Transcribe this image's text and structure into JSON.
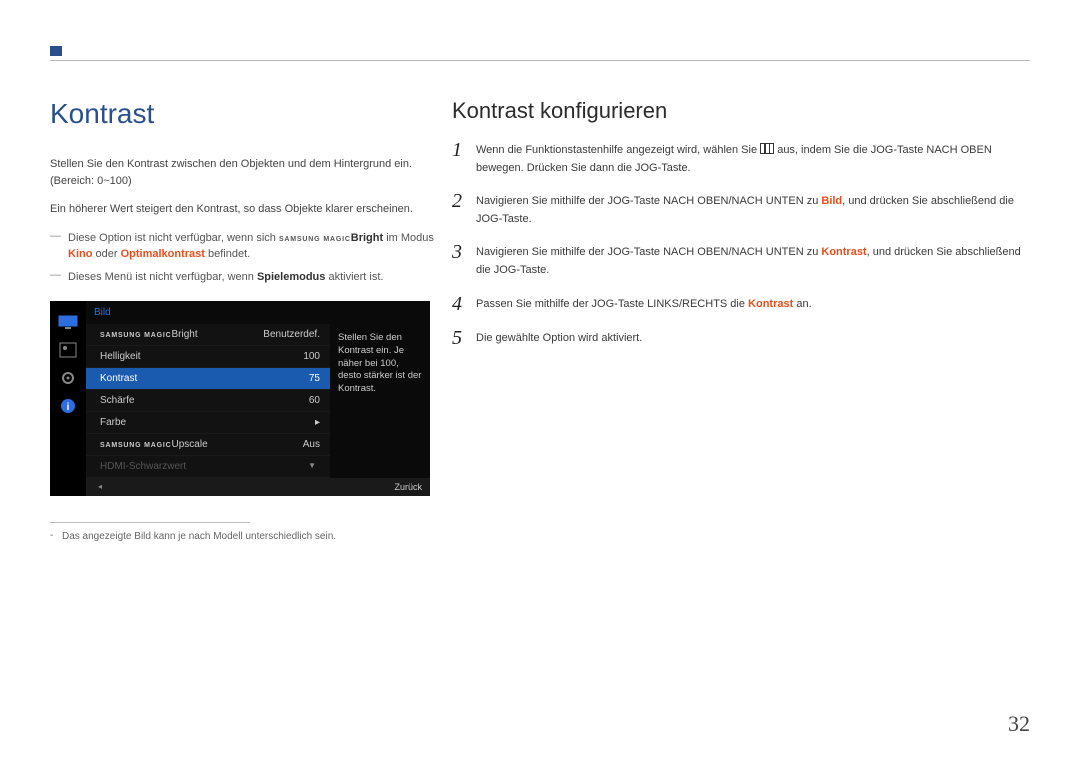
{
  "left": {
    "heading": "Kontrast",
    "intro": "Stellen Sie den Kontrast zwischen den Objekten und dem Hintergrund ein. (Bereich: 0~100)",
    "intro2": "Ein höherer Wert steigert den Kontrast, so dass Objekte klarer erscheinen.",
    "note1_a": "Diese Option ist nicht verfügbar, wenn sich ",
    "note1_magic_small": "SAMSUNG",
    "note1_magic": "MAGIC",
    "note1_bright": "Bright",
    "note1_b": " im Modus ",
    "note1_kino": "Kino",
    "note1_c": " oder ",
    "note1_opt": "Optimalkontrast",
    "note1_d": " befindet.",
    "note2_a": "Dieses Menü ist nicht verfügbar, wenn ",
    "note2_bold": "Spielemodus",
    "note2_b": " aktiviert ist.",
    "footnote": "Das angezeigte Bild kann je nach Modell unterschiedlich sein."
  },
  "osd": {
    "header": "Bild",
    "desc": "Stellen Sie den Kontrast ein. Je näher bei 100, desto stärker ist der Kontrast.",
    "rows": [
      {
        "label_prefix": "SAMSUNG",
        "label_magic": "MAGIC",
        "label_suffix": "Bright",
        "value": "Benutzerdef."
      },
      {
        "label": "Helligkeit",
        "value": "100"
      },
      {
        "label": "Kontrast",
        "value": "75"
      },
      {
        "label": "Schärfe",
        "value": "60"
      },
      {
        "label": "Farbe",
        "value": "▸"
      },
      {
        "label_prefix": "SAMSUNG",
        "label_magic": "MAGIC",
        "label_suffix": "Upscale",
        "value": "Aus"
      },
      {
        "label": "HDMI-Schwarzwert",
        "value": ""
      }
    ],
    "footer_back": "Zurück"
  },
  "right": {
    "heading": "Kontrast konfigurieren",
    "steps": [
      {
        "n": "1",
        "a": "Wenn die Funktionstastenhilfe angezeigt wird, wählen Sie ",
        "b": " aus, indem Sie die JOG-Taste NACH OBEN bewegen. Drücken Sie dann die JOG-Taste."
      },
      {
        "n": "2",
        "a": "Navigieren Sie mithilfe der JOG-Taste NACH OBEN/NACH UNTEN zu ",
        "bold": "Bild",
        "b": ", und drücken Sie abschließend die JOG-Taste."
      },
      {
        "n": "3",
        "a": "Navigieren Sie mithilfe der JOG-Taste NACH OBEN/NACH UNTEN zu ",
        "bold": "Kontrast",
        "b": ", und drücken Sie abschließend die JOG-Taste."
      },
      {
        "n": "4",
        "a": "Passen Sie mithilfe der JOG-Taste LINKS/RECHTS die ",
        "bold": "Kontrast",
        "b": " an."
      },
      {
        "n": "5",
        "a": "Die gewählte Option wird aktiviert.",
        "bold": "",
        "b": ""
      }
    ]
  },
  "page_number": "32"
}
